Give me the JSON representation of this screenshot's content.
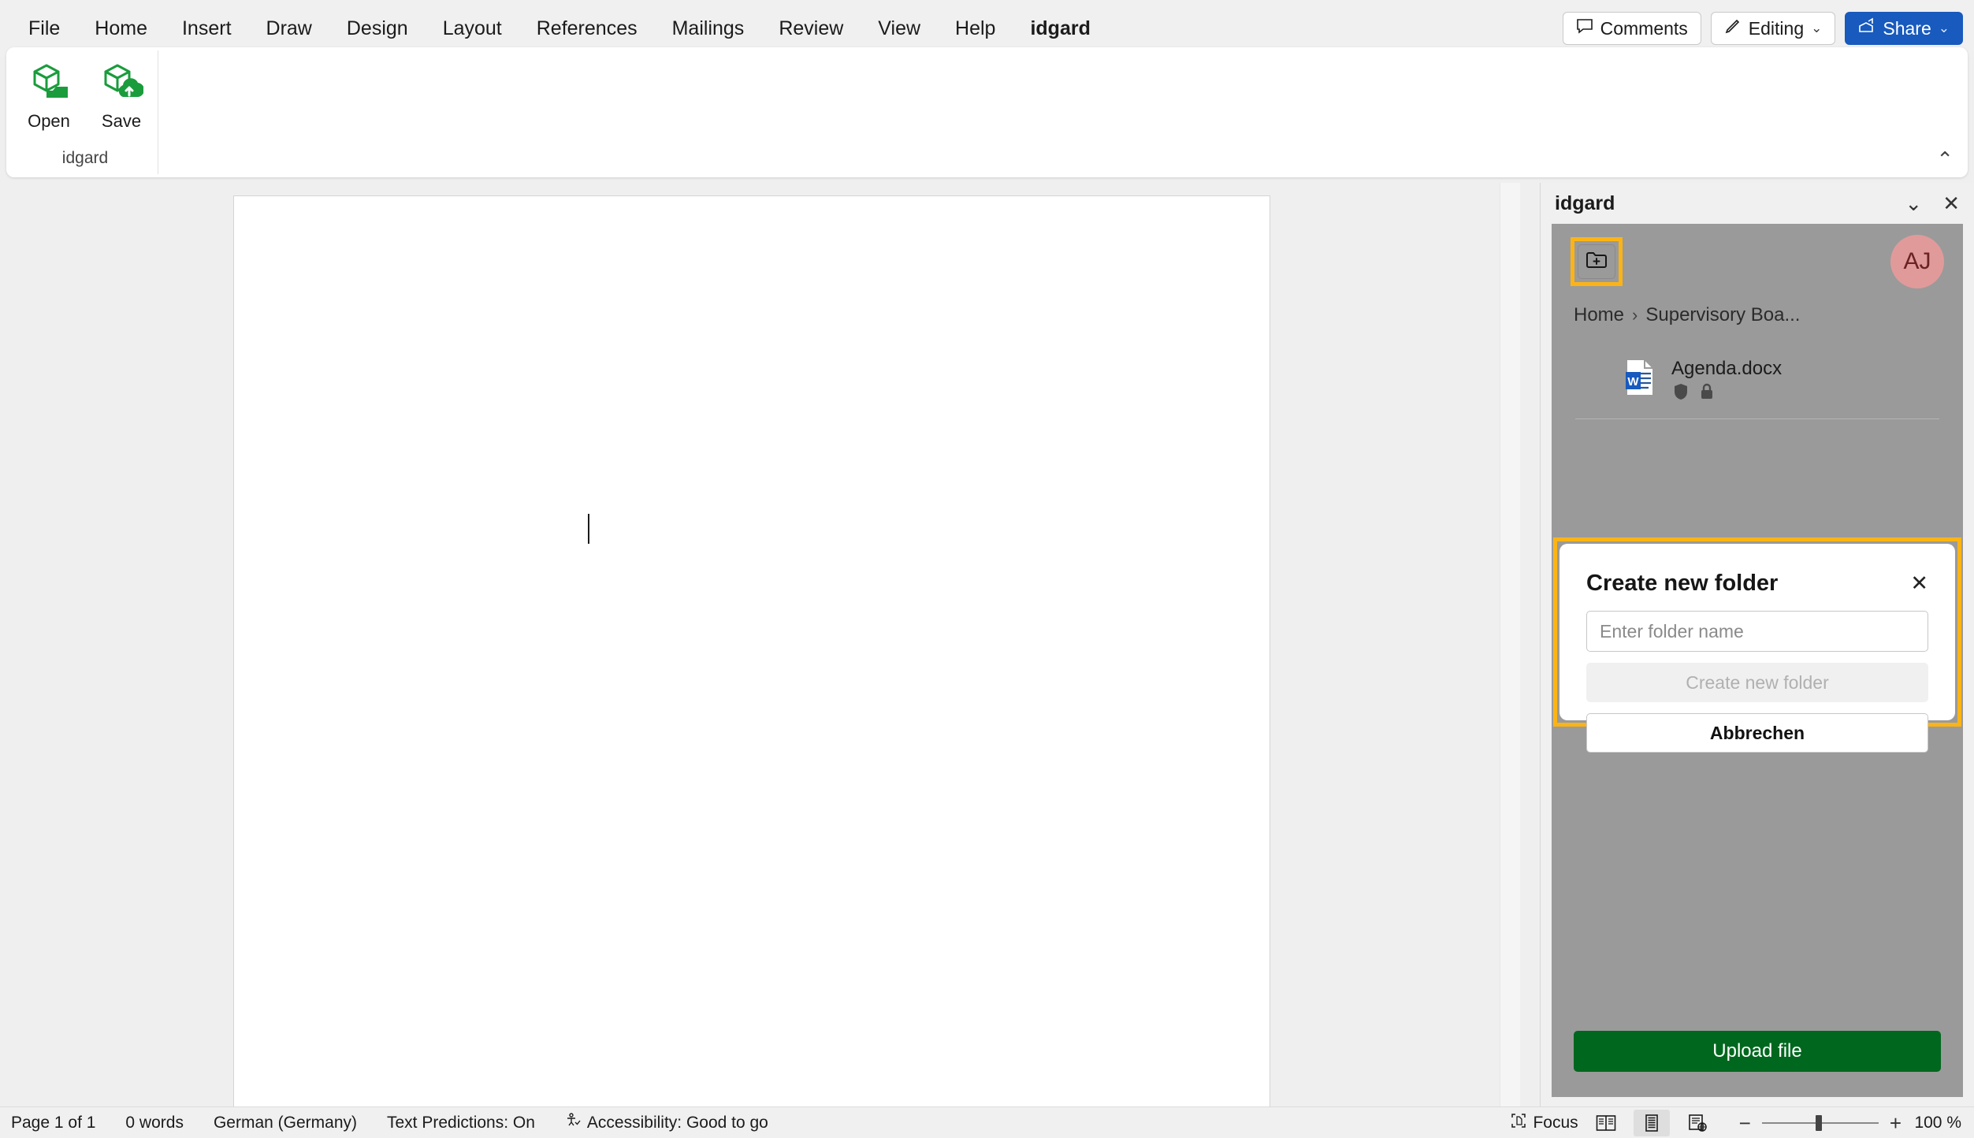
{
  "ribbon_tabs": [
    {
      "label": "File",
      "active": false
    },
    {
      "label": "Home",
      "active": false
    },
    {
      "label": "Insert",
      "active": false
    },
    {
      "label": "Draw",
      "active": false
    },
    {
      "label": "Design",
      "active": false
    },
    {
      "label": "Layout",
      "active": false
    },
    {
      "label": "References",
      "active": false
    },
    {
      "label": "Mailings",
      "active": false
    },
    {
      "label": "Review",
      "active": false
    },
    {
      "label": "View",
      "active": false
    },
    {
      "label": "Help",
      "active": false
    },
    {
      "label": "idgard",
      "active": true
    }
  ],
  "topright": {
    "comments_label": "Comments",
    "editing_label": "Editing",
    "share_label": "Share",
    "chevron": "⌄",
    "share_bg": "#185abd"
  },
  "ribbon": {
    "group_label": "idgard",
    "buttons": [
      {
        "label": "Open",
        "icon": "open-cube-folder-icon"
      },
      {
        "label": "Save",
        "icon": "save-cube-cloud-icon"
      }
    ],
    "collapse_icon": "⌃",
    "icon_color": "#1a9c3c"
  },
  "document": {
    "zoom_percent": "100 %"
  },
  "panel": {
    "title": "idgard",
    "collapse_icon": "⌄",
    "close_icon": "✕",
    "new_folder_button_icon": "folder-plus-icon",
    "highlight_color": "#fcb415",
    "avatar_initials": "AJ",
    "avatar_bg": "#e19a9a",
    "breadcrumb": [
      {
        "label": "Home"
      },
      {
        "label": "Supervisory Boa..."
      }
    ],
    "breadcrumb_separator": "›",
    "files": [
      {
        "name": "Agenda.docx",
        "icon": "word-document-icon",
        "badges": [
          "shield-icon",
          "lock-icon"
        ]
      }
    ],
    "upload_label": "Upload file",
    "upload_bg": "#00671e"
  },
  "modal": {
    "title": "Create new folder",
    "close_icon": "✕",
    "input_placeholder": "Enter folder name",
    "input_value": "",
    "submit_label": "Create new folder",
    "submit_disabled": true,
    "cancel_label": "Abbrechen"
  },
  "statusbar": {
    "page": "Page 1 of 1",
    "words": "0 words",
    "language": "German (Germany)",
    "text_predictions": "Text Predictions: On",
    "accessibility": "Accessibility: Good to go",
    "focus": "Focus",
    "views": [
      {
        "name": "read-mode",
        "active": false
      },
      {
        "name": "print-layout",
        "active": true
      },
      {
        "name": "web-layout",
        "active": false
      }
    ],
    "zoom_minus": "−",
    "zoom_plus": "+",
    "zoom_value": "100 %"
  }
}
